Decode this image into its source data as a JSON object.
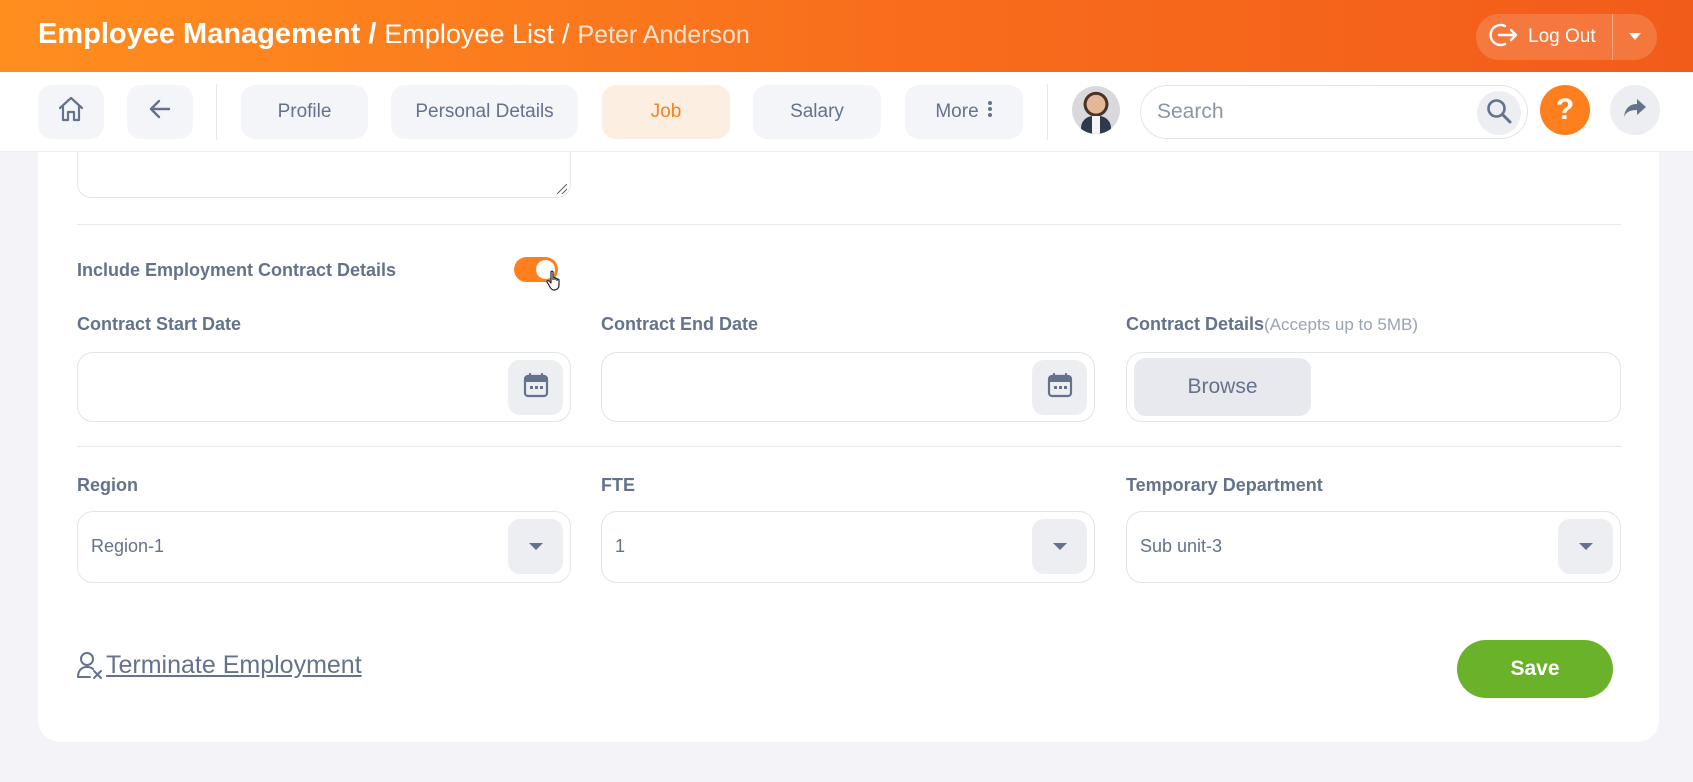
{
  "header": {
    "module": "Employee Management",
    "separator": "/",
    "list": "Employee List",
    "employee": "Peter Anderson",
    "logout_label": "Log Out"
  },
  "nav": {
    "tabs": [
      {
        "label": "Profile"
      },
      {
        "label": "Personal Details"
      },
      {
        "label": "Job",
        "active": true
      },
      {
        "label": "Salary"
      },
      {
        "label": "More"
      }
    ],
    "search_placeholder": "Search",
    "help_symbol": "?"
  },
  "form": {
    "contract_toggle_label": "Include Employment Contract Details",
    "contract_toggle_on": true,
    "contract_start_label": "Contract Start Date",
    "contract_start_value": "",
    "contract_end_label": "Contract End Date",
    "contract_end_value": "",
    "contract_details_label": "Contract Details",
    "contract_details_note": "(Accepts up to 5MB)",
    "browse_label": "Browse",
    "region_label": "Region",
    "region_value": "Region-1",
    "fte_label": "FTE",
    "fte_value": "1",
    "temp_dept_label": "Temporary Department",
    "temp_dept_value": "Sub unit-3"
  },
  "actions": {
    "terminate_label": "Terminate Employment",
    "save_label": "Save"
  },
  "colors": {
    "brand_orange": "#ff7f1e",
    "save_green": "#69b22a",
    "text": "#64728c"
  },
  "icons": [
    "home-icon",
    "back-arrow-icon",
    "more-dots-icon",
    "search-icon",
    "help-icon",
    "share-icon",
    "logout-icon",
    "chevron-down-icon",
    "calendar-icon",
    "user-remove-icon"
  ]
}
